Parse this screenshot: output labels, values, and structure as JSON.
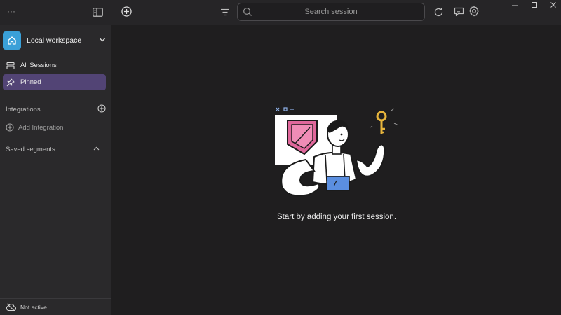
{
  "topbar": {
    "more_label": "···",
    "search_placeholder": "Search session",
    "window_controls": [
      "minimize",
      "maximize",
      "close"
    ]
  },
  "sidebar": {
    "workspace": "Local workspace",
    "items": [
      {
        "label": "All Sessions",
        "icon": "list-icon"
      },
      {
        "label": "Pinned",
        "icon": "pin-icon",
        "active": true
      }
    ],
    "integrations_label": "Integrations",
    "add_integration_label": "Add Integration",
    "saved_segments_label": "Saved segments",
    "status_label": "Not active"
  },
  "main": {
    "empty_message": "Start by adding your first session."
  },
  "colors": {
    "accent": "#524475",
    "workspace_logo": "#3aa0d8",
    "shield_pink": "#e0679b",
    "key_yellow": "#e7b53c",
    "shirt_blue": "#5b8fe0"
  }
}
